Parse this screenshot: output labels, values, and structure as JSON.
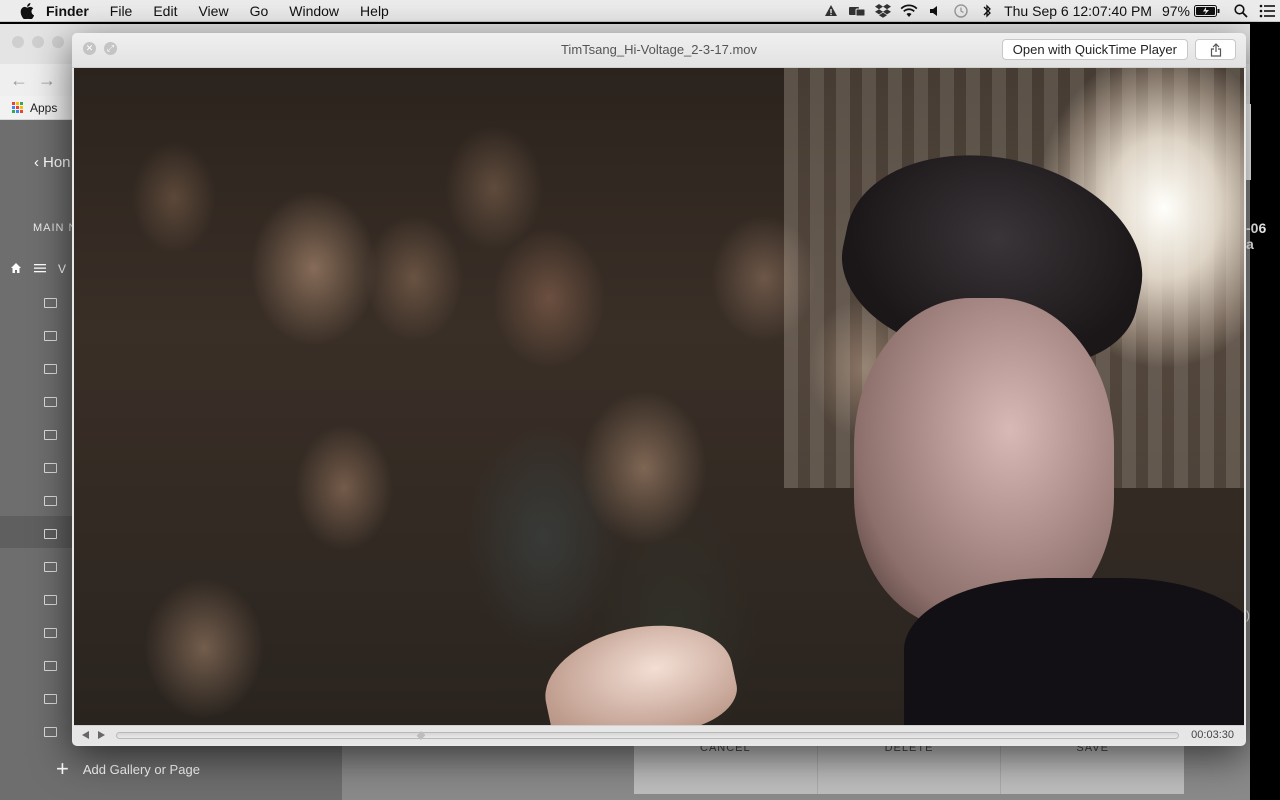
{
  "menubar": {
    "app_name": "Finder",
    "menus": [
      "File",
      "Edit",
      "View",
      "Go",
      "Window",
      "Help"
    ],
    "clock": "Thu Sep 6  12:07:40 PM",
    "battery": "97%"
  },
  "background_app": {
    "bookmarks_apps": "Apps",
    "home_link": "Hon",
    "section_label": "MAIN N",
    "nav_glyph": "V",
    "add_gallery": "Add Gallery or Page",
    "dialog_buttons": [
      "CANCEL",
      "DELETE",
      "SAVE"
    ],
    "edge_text_top": "-06 a",
    "edge_text_mid": ")"
  },
  "quicklook": {
    "file_name": "TimTsang_Hi-Voltage_2-3-17.mov",
    "open_with_label": "Open with QuickTime Player",
    "playback_time": "00:03:30",
    "playhead_fraction": 0.285
  },
  "colors": {
    "menubar_bg": "#ececec",
    "window_chrome": "#e8e8e8",
    "bg_sidebar": "#6e6e6e"
  }
}
